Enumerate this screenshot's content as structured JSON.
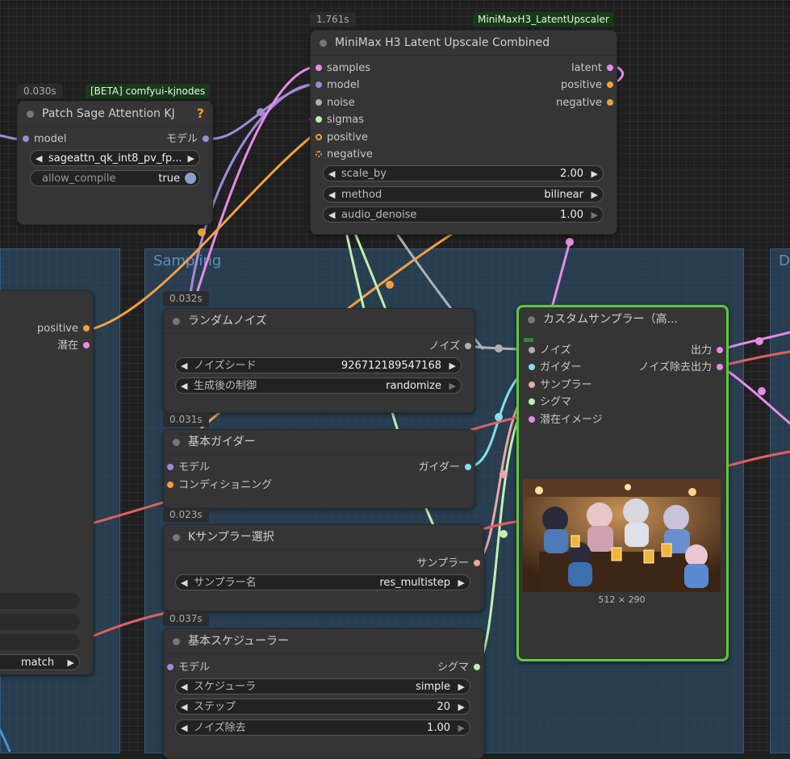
{
  "colors": {
    "selected_border": "#5fc83c",
    "group_fill": "#305676",
    "accent_badge": "#173a17"
  },
  "groups": {
    "sampling_title": "Sampling",
    "right_title": "D"
  },
  "minimax": {
    "time": "1.761s",
    "pack": "MiniMaxH3_LatentUpscaler",
    "title": "MiniMax H3 Latent Upscale Combined",
    "inputs": [
      "samples",
      "model",
      "noise",
      "sigmas",
      "positive",
      "negative"
    ],
    "outputs": [
      "latent",
      "positive",
      "negative"
    ],
    "widgets": [
      {
        "label": "scale_by",
        "value": "2.00"
      },
      {
        "label": "method",
        "value": "bilinear"
      },
      {
        "label": "audio_denoise",
        "value": "1.00"
      }
    ]
  },
  "patch": {
    "time": "0.030s",
    "pack": "[BETA] comfyui-kjnodes",
    "title": "Patch Sage Attention KJ",
    "help": "?",
    "input": "model",
    "output": "モデル",
    "combo_value": "sageattn_qk_int8_pv_fp...",
    "toggle_label": "allow_compile",
    "toggle_value": "true"
  },
  "left_node": {
    "outputs": [
      "positive",
      "潜在"
    ],
    "last_value": "match"
  },
  "noise_node": {
    "time": "0.032s",
    "title": "ランダムノイズ",
    "output": "ノイズ",
    "widgets": [
      {
        "label": "ノイズシード",
        "value": "926712189547168"
      },
      {
        "label": "生成後の制御",
        "value": "randomize"
      }
    ]
  },
  "guider_node": {
    "time": "0.031s",
    "title": "基本ガイダー",
    "inputs": [
      "モデル",
      "コンディショニング"
    ],
    "output": "ガイダー"
  },
  "ksampler_select": {
    "time": "0.023s",
    "title": "Kサンプラー選択",
    "output": "サンプラー",
    "widget": {
      "label": "サンプラー名",
      "value": "res_multistep"
    }
  },
  "scheduler_node": {
    "time": "0.037s",
    "title": "基本スケジューラー",
    "input": "モデル",
    "output": "シグマ",
    "widgets": [
      {
        "label": "スケジューラ",
        "value": "simple"
      },
      {
        "label": "ステップ",
        "value": "20"
      },
      {
        "label": "ノイズ除去",
        "value": "1.00"
      }
    ]
  },
  "custom_sampler": {
    "title": "カスタムサンプラー（高...",
    "inputs": [
      "ノイズ",
      "ガイダー",
      "サンプラー",
      "シグマ",
      "潜在イメージ"
    ],
    "outputs": [
      "出力",
      "ノイズ除去出力"
    ],
    "preview_caption": "512 × 290"
  }
}
